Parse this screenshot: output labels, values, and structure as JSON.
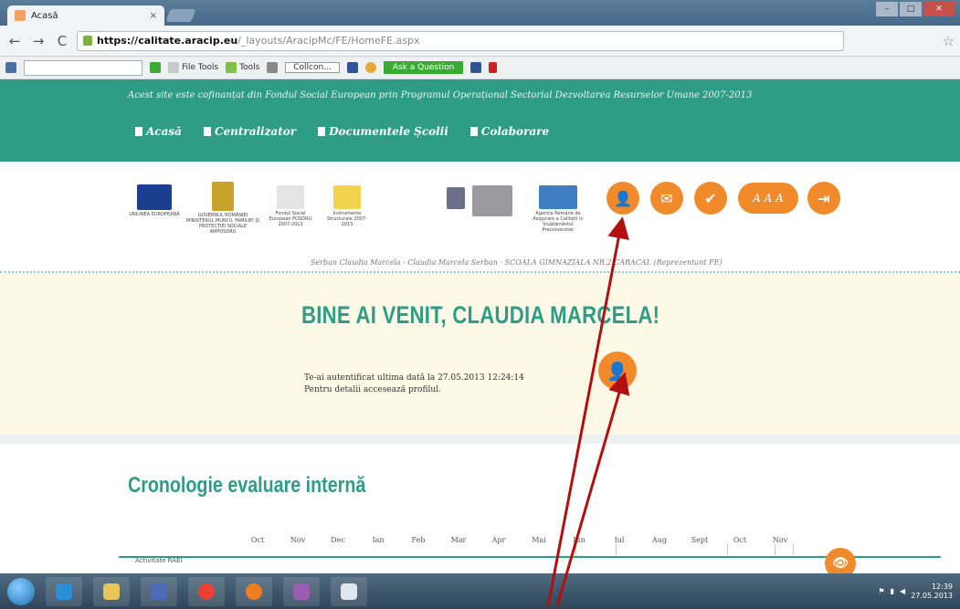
{
  "browser": {
    "tab_title": "Acasă",
    "tab_close": "×",
    "url_host": "https://calitate.aracip.eu",
    "url_path": "/_layouts/AracipMc/FE/HomeFE.aspx",
    "back": "←",
    "forward": "→",
    "reload": "C",
    "star": "☆"
  },
  "toolbar": {
    "file_tools": "File Tools",
    "tools": "Tools",
    "collcon": "Collcon...",
    "ask": "Ask a Question"
  },
  "site": {
    "funding_text": "Acest site este cofinanțat din Fondul Social European prin Programul Operațional Sectorial Dezvoltarea Resurselor Umane 2007-2013",
    "menu": [
      {
        "label": "Acasă"
      },
      {
        "label": "Centralizator"
      },
      {
        "label": "Documentele Școlii"
      },
      {
        "label": "Colaborare"
      }
    ]
  },
  "logos": [
    {
      "caption": "UNIUNEA EUROPEANĂ",
      "color": "#1b3f8f"
    },
    {
      "caption": "GUVERNUL ROMÂNIEI MINISTERUL MUNCII, FAMILIEI ȘI PROTECȚIEI SOCIALE AMPOSDRU",
      "color": "#c9a227"
    },
    {
      "caption": "Fondul Social European POSDRU 2007-2013",
      "color": "#e4e4e4"
    },
    {
      "caption": "Instrumente Structurale 2007-2013",
      "color": "#f0d34a"
    },
    {
      "caption": "",
      "color": "#6b6f8a"
    },
    {
      "caption": "",
      "color": "#9a9aa0"
    },
    {
      "caption": "Agenția Română de Asigurare a Calității în Învățământul Preuniversitar",
      "color": "#3e7fc4"
    }
  ],
  "icons": {
    "profile": "👤",
    "messages": "✉",
    "check": "✔",
    "font_size": "A A A",
    "logout": "⇥",
    "eye": "👁"
  },
  "user_line": "Serban Claudia Marcela - Claudia Marcela Serban - SCOALA GIMNAZIALA NR.2 CARACAL (Reprezentant FE)",
  "welcome": {
    "title": "BINE AI VENIT, CLAUDIA MARCELA!",
    "line1": "Te-ai autentificat ultima dată la 27.05.2013 12:24:14",
    "line2": "Pentru detalii accesează profilul."
  },
  "chronology": {
    "title": "Cronologie evaluare internă",
    "months": [
      "Oct",
      "Nov",
      "Dec",
      "Ian",
      "Feb",
      "Mar",
      "Apr",
      "Mai",
      "Iun",
      "Iul",
      "Aug",
      "Sept",
      "Oct",
      "Nov"
    ],
    "row_label": "Activitate RAEI"
  },
  "taskbar": {
    "time": "12:39",
    "date": "27.05.2013"
  },
  "colors": {
    "teal": "#2f9c85",
    "orange": "#f08a2a",
    "arrow_red": "#b01010",
    "welcome_bg": "#fdf9e6"
  }
}
